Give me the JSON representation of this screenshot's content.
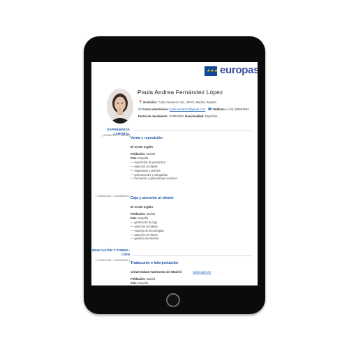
{
  "brand": {
    "logo_text": "europass",
    "flag_stars": "★★★"
  },
  "cv": {
    "name": "Paula Andrea Fernández López",
    "address_label": "Domicilio",
    "address": ": Calle Camarena 111, 28047, Madrid, España",
    "email_label": "Correo electrónico:",
    "email": "pafernandez10@gmail.com",
    "phone_label": "Teléfono:",
    "phone": "(+34) 628563984",
    "birth_label": "Fecha de nacimiento:",
    "birth": "10/09/2000",
    "nationality_label": "Nacionalidad:",
    "nationality": "Española"
  },
  "sections": {
    "experience_heading": "EXPERIENCIA LABORAL",
    "education_heading_1": "EDUCACIÓN Y FORMA-",
    "education_heading_2": "CIÓN"
  },
  "labels": {
    "city": "Población:",
    "country": "País:"
  },
  "jobs": [
    {
      "date": "[ 20/08/2023 – Actual ]",
      "title": "Venta y reposición",
      "employer": "El Corte Inglés",
      "city": "Madrid",
      "country": "España",
      "tasks": [
        "— reposición de productos",
        "— atención al cliente",
        "— etiquetado y precios",
        "— promociones y campañas",
        "— formación y aprendizaje continuo"
      ]
    },
    {
      "date": "[ 14/03/2022 – 20/08/2023 ]",
      "title": "Caja y atención al cliente",
      "employer": "El Corte Inglés",
      "city": "Madrid",
      "country": "España",
      "tasks": [
        "— gestión de la caja",
        "— atención al cliente",
        "— manejo de tecnologías",
        "— atención al cliente",
        "— gestión inventarios"
      ]
    }
  ],
  "education": {
    "date": "[ 20/09/2018 – 09/06/2022 ]",
    "title": "Traducción e Interpretación",
    "institution": "Universidad Autónoma de Madrid",
    "website": "www.uam.es",
    "city": "Madrid",
    "country": "España"
  }
}
